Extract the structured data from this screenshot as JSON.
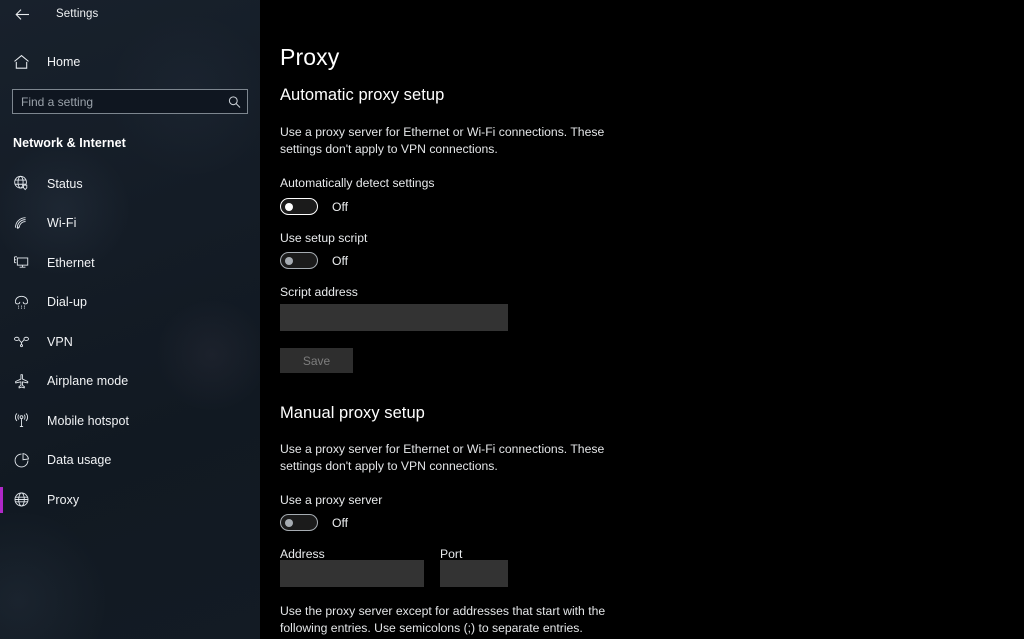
{
  "window": {
    "titlebar_title": "Settings",
    "back_icon": "back-arrow-icon"
  },
  "sidebar": {
    "home_label": "Home",
    "home_icon": "home-icon",
    "search": {
      "placeholder": "Find a setting",
      "value": "",
      "icon": "search-icon"
    },
    "category_label": "Network & Internet",
    "accent_color": "#b028c8",
    "items": [
      {
        "label": "Status",
        "icon": "status-globe-icon",
        "selected": false
      },
      {
        "label": "Wi-Fi",
        "icon": "wifi-icon",
        "selected": false
      },
      {
        "label": "Ethernet",
        "icon": "ethernet-monitor-icon",
        "selected": false
      },
      {
        "label": "Dial-up",
        "icon": "dialup-phone-icon",
        "selected": false
      },
      {
        "label": "VPN",
        "icon": "vpn-nodes-icon",
        "selected": false
      },
      {
        "label": "Airplane mode",
        "icon": "airplane-icon",
        "selected": false
      },
      {
        "label": "Mobile hotspot",
        "icon": "hotspot-signal-icon",
        "selected": false
      },
      {
        "label": "Data usage",
        "icon": "pie-chart-icon",
        "selected": false
      },
      {
        "label": "Proxy",
        "icon": "globe-icon",
        "selected": true
      }
    ]
  },
  "main": {
    "page_title": "Proxy",
    "automatic": {
      "heading": "Automatic proxy setup",
      "description": "Use a proxy server for Ethernet or Wi-Fi connections. These settings don't apply to VPN connections.",
      "auto_detect": {
        "label": "Automatically detect settings",
        "state": "Off"
      },
      "setup_script": {
        "label": "Use setup script",
        "state": "Off"
      },
      "script_address": {
        "label": "Script address",
        "value": "",
        "placeholder": ""
      },
      "save_label": "Save"
    },
    "manual": {
      "heading": "Manual proxy setup",
      "description": "Use a proxy server for Ethernet or Wi-Fi connections. These settings don't apply to VPN connections.",
      "use_proxy": {
        "label": "Use a proxy server",
        "state": "Off"
      },
      "address": {
        "label": "Address",
        "value": "",
        "placeholder": ""
      },
      "port": {
        "label": "Port",
        "value": "",
        "placeholder": ""
      },
      "exceptions_note": "Use the proxy server except for addresses that start with the following entries. Use semicolons (;) to separate entries."
    }
  }
}
